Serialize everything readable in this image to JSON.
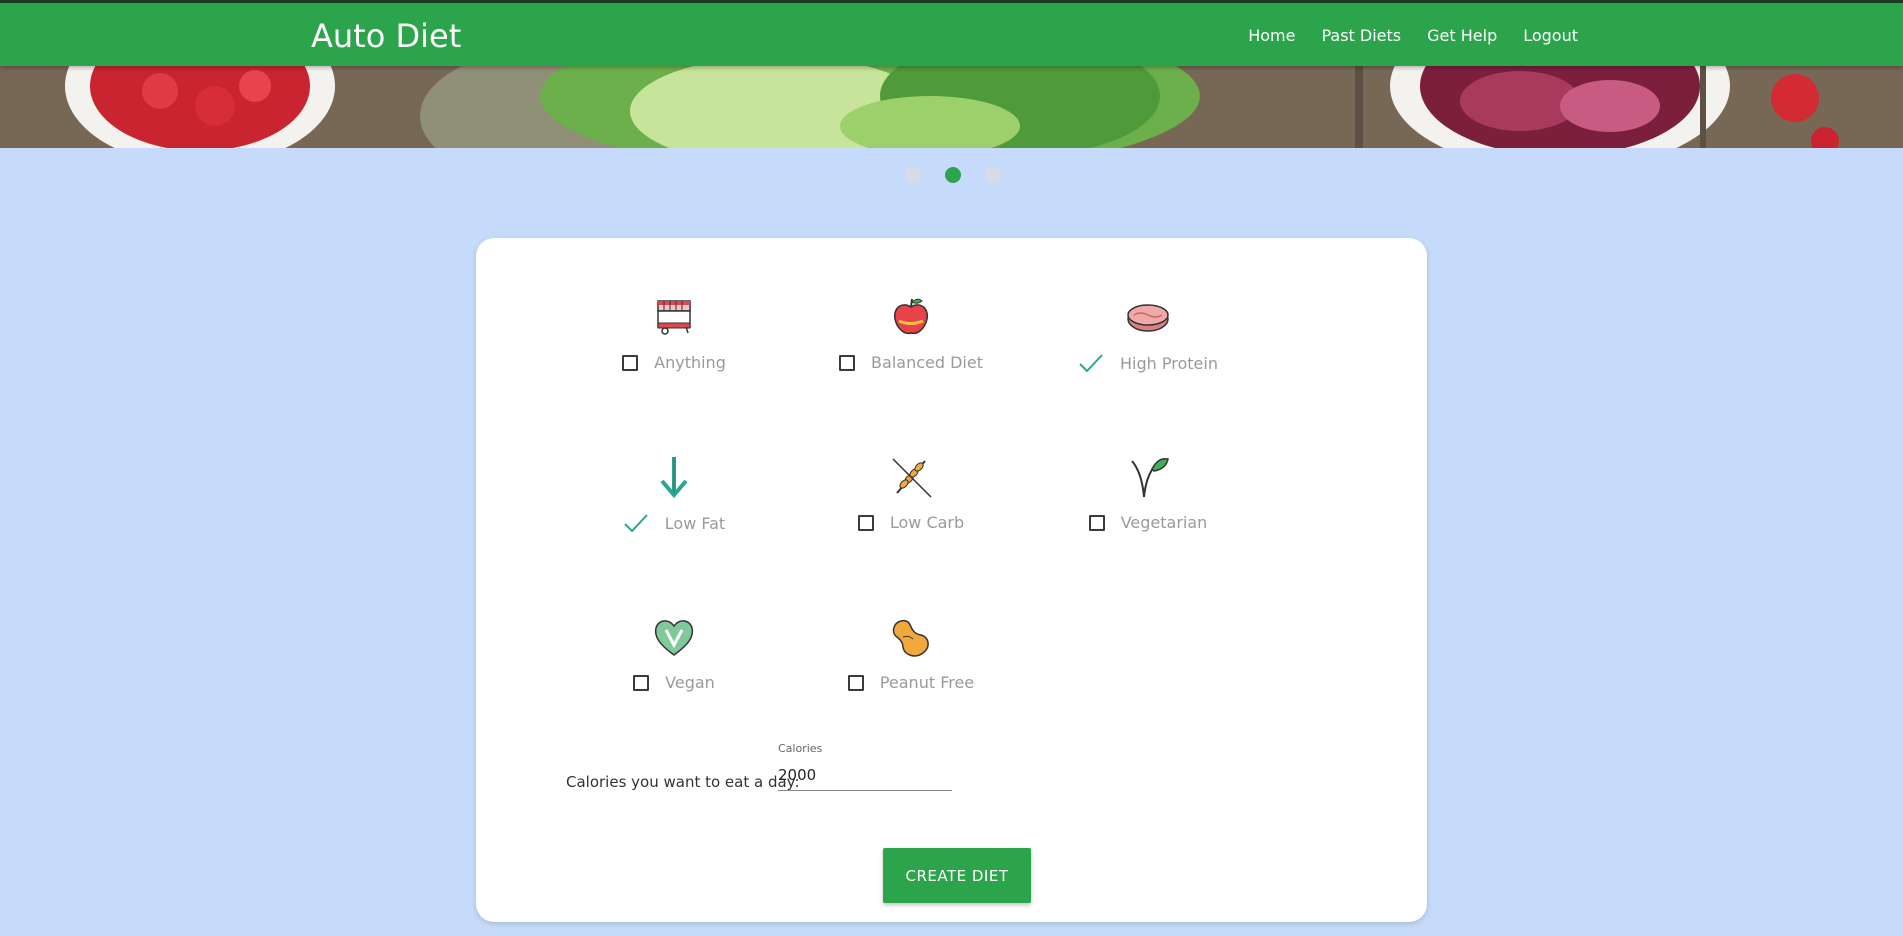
{
  "app": {
    "title": "Auto Diet"
  },
  "nav": {
    "home": "Home",
    "past_diets": "Past Diets",
    "get_help": "Get Help",
    "logout": "Logout"
  },
  "carousel": {
    "slide_count": 3,
    "active_index": 1
  },
  "diet_options": [
    {
      "label": "Anything",
      "icon": "food-cart-icon",
      "checked": false
    },
    {
      "label": "Balanced Diet",
      "icon": "apple-icon",
      "checked": false
    },
    {
      "label": "High Protein",
      "icon": "steak-icon",
      "checked": true
    },
    {
      "label": "Low Fat",
      "icon": "down-arrow-icon",
      "checked": true
    },
    {
      "label": "Low Carb",
      "icon": "no-wheat-icon",
      "checked": false
    },
    {
      "label": "Vegetarian",
      "icon": "sprout-icon",
      "checked": false
    },
    {
      "label": "Vegan",
      "icon": "vegan-heart-icon",
      "checked": false
    },
    {
      "label": "Peanut Free",
      "icon": "peanut-icon",
      "checked": false
    }
  ],
  "calories": {
    "label": "Calories you want to eat a day:",
    "field_label": "Calories",
    "value": "2000"
  },
  "create_button": "CREATE DIET",
  "colors": {
    "brand": "#2ba44c",
    "check": "#2aa58f",
    "background": "#c6dbfb"
  }
}
